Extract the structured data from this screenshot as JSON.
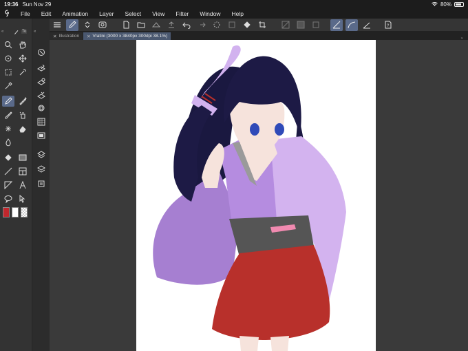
{
  "status": {
    "time": "19:36",
    "date": "Sun Nov 29",
    "battery": "80%",
    "battery_level": 0.8
  },
  "menu": {
    "items": [
      "File",
      "Edit",
      "Animation",
      "Layer",
      "Select",
      "View",
      "Filter",
      "Window",
      "Help"
    ]
  },
  "tabs": [
    {
      "label": "Illustration",
      "active": false
    },
    {
      "label": "Vratini (3000 x 3840px 300dpi 38.1%)",
      "active": true
    }
  ],
  "tool_panel": {
    "header_label": "To"
  },
  "colors": {
    "main": "#c0272d",
    "sub": "#ffffff",
    "accent": "#5a6a8a"
  },
  "canvas": {
    "background": "#ffffff"
  }
}
